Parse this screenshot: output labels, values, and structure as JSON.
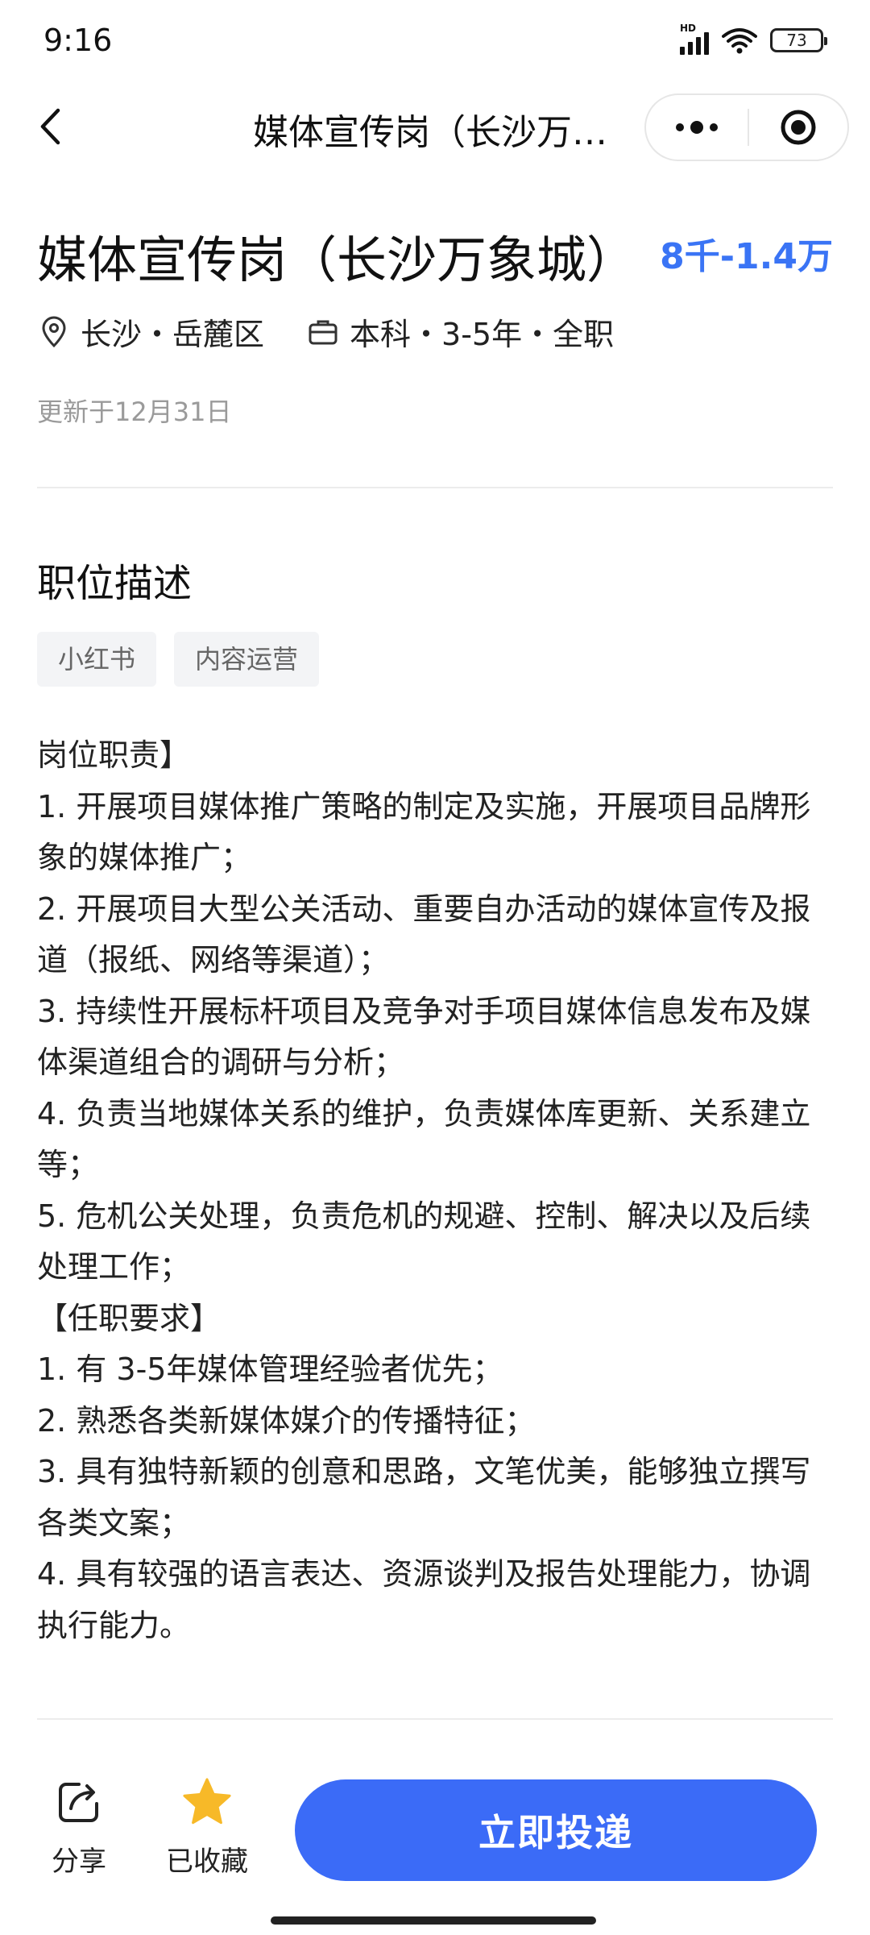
{
  "status_bar": {
    "time": "9:16",
    "hd_label": "HD",
    "battery": "73"
  },
  "nav": {
    "title": "媒体宣传岗（长沙万…"
  },
  "job": {
    "title": "媒体宣传岗（长沙万象城）",
    "salary": "8千-1.4万",
    "location": "长沙・岳麓区",
    "requirements": "本科・3-5年・全职",
    "updated": "更新于12月31日"
  },
  "description": {
    "section_title": "职位描述",
    "tags": [
      "小红书",
      "内容运营"
    ],
    "lines": [
      "岗位职责】",
      "1. 开展项目媒体推广策略的制定及实施，开展项目品牌形象的媒体推广；",
      "2. 开展项目大型公关活动、重要自办活动的媒体宣传及报道（报纸、网络等渠道）；",
      "3. 持续性开展标杆项目及竞争对手项目媒体信息发布及媒体渠道组合的调研与分析；",
      "4. 负责当地媒体关系的维护，负责媒体库更新、关系建立等；",
      "5. 危机公关处理，负责危机的规避、控制、解决以及后续处理工作；",
      "【任职要求】",
      "1. 有 3-5年媒体管理经验者优先；",
      "2. 熟悉各类新媒体媒介的传播特征；",
      "3. 具有独特新颖的创意和思路，文笔优美，能够独立撰写各类文案；",
      "4. 具有较强的语言表达、资源谈判及报告处理能力，协调执行能力。"
    ]
  },
  "bottom_bar": {
    "share_label": "分享",
    "favorite_label": "已收藏",
    "apply_label": "立即投递"
  },
  "colors": {
    "accent": "#3b6bf7",
    "salary": "#3a74f5",
    "star": "#f7b928"
  }
}
